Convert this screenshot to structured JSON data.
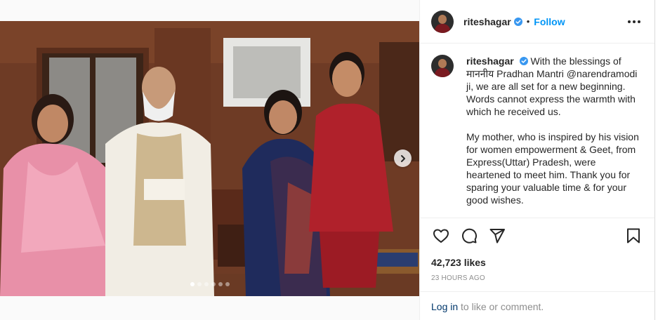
{
  "post": {
    "username": "riteshagar",
    "separator": "•",
    "follow_label": "Follow",
    "more_icon": "more-options-icon",
    "verified_color": "#3897f0"
  },
  "caption": {
    "username": "riteshagar",
    "line1": "With the blessings of माननीय Pradhan Mantri @narendramodi ji, we are all set for a new beginning. Words cannot express the warmth with which he received us.",
    "line2": "My mother, who is inspired by his vision for women empowerment & Geet, from Express(Uttar) Pradesh, were heartened to meet him. Thank you for sparing your valuable time & for your good wishes."
  },
  "carousel": {
    "dot_count": 6,
    "active_index": 0,
    "next_icon": "chevron-right-icon"
  },
  "actions": {
    "like_icon": "heart-icon",
    "comment_icon": "comment-icon",
    "share_icon": "share-icon",
    "save_icon": "bookmark-icon"
  },
  "stats": {
    "likes": "42,723 likes",
    "time": "23 hours ago"
  },
  "footer": {
    "login_label": "Log in",
    "rest": " to like or comment."
  },
  "colors": {
    "accent": "#0095f6",
    "link_dark": "#00376b",
    "muted": "#8e8e8e"
  }
}
